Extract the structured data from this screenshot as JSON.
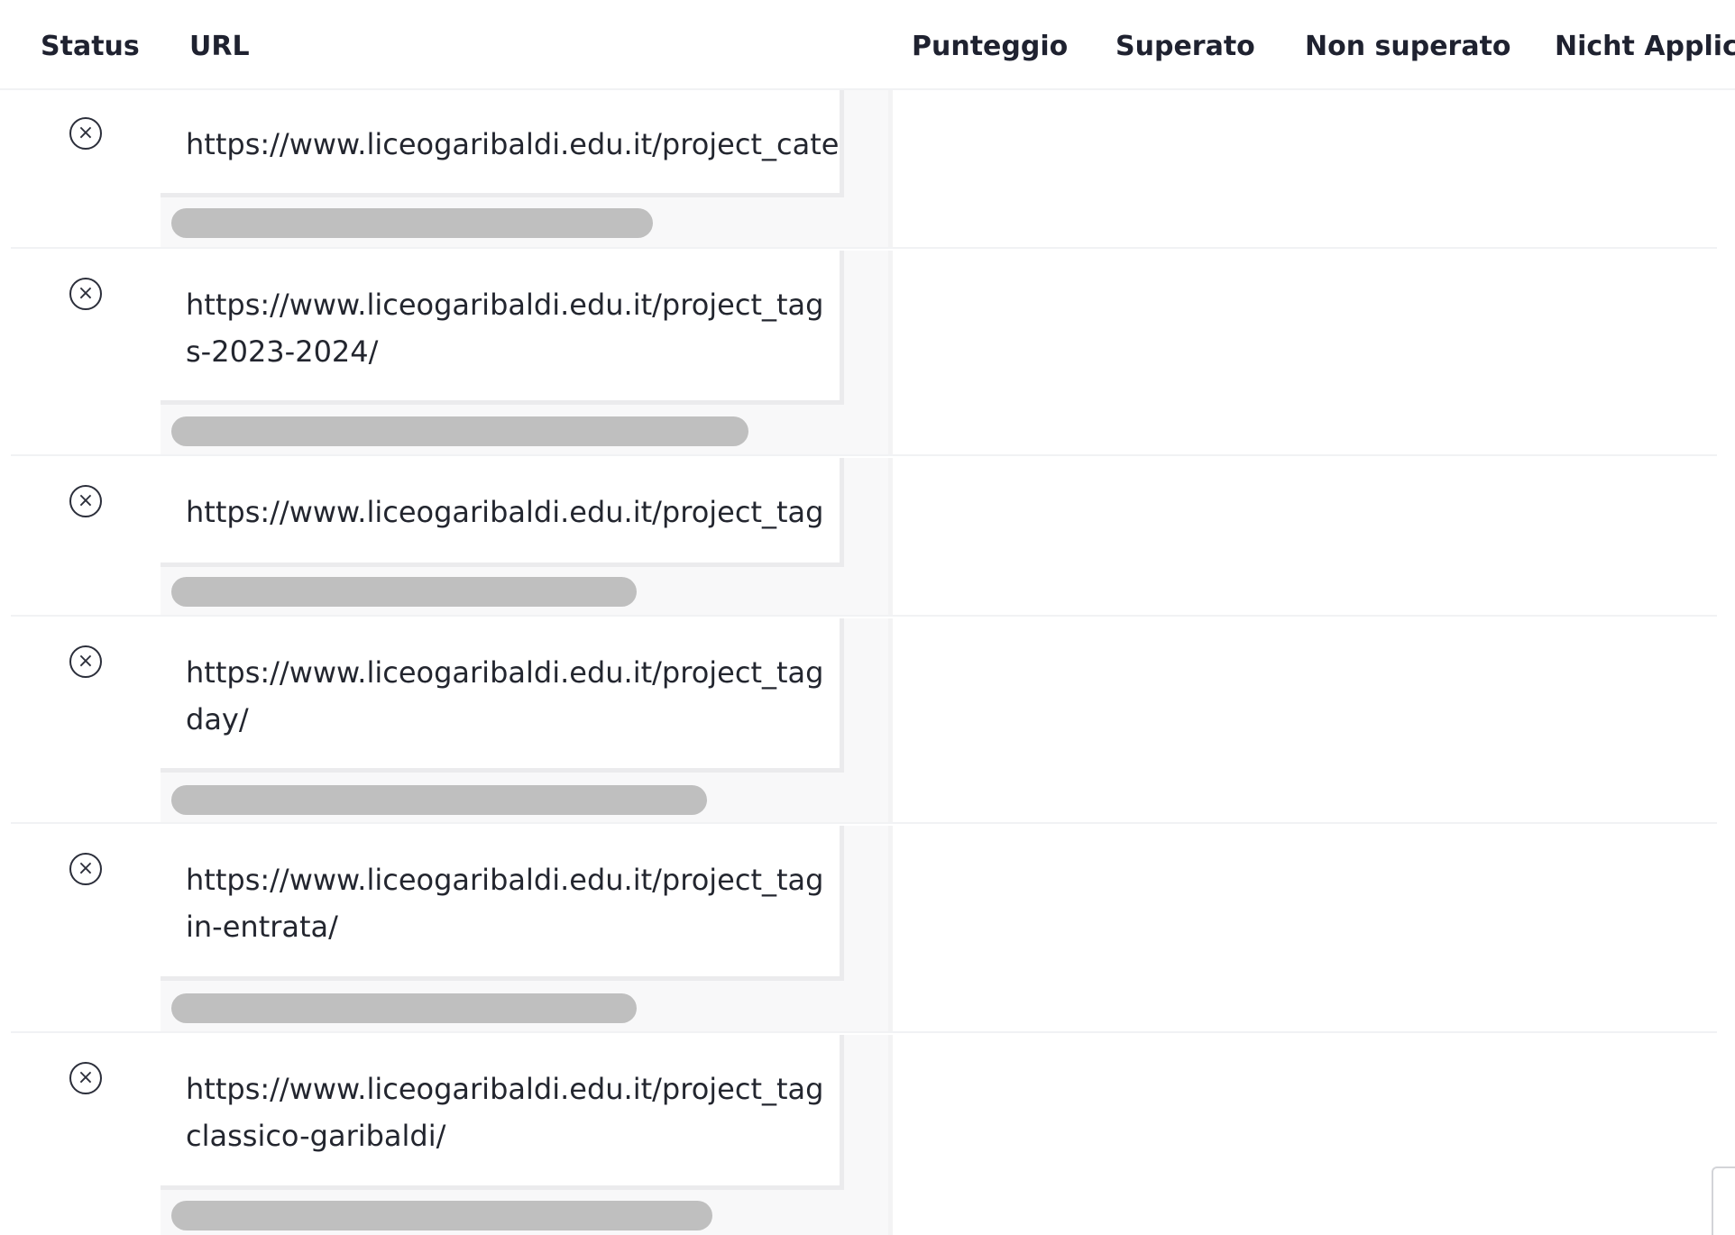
{
  "table": {
    "headers": {
      "status": "Status",
      "url": "URL",
      "score": "Punteggio",
      "passed": "Superato",
      "not_passed": "Non superato",
      "not_applicable": "Nicht Applic"
    },
    "rows": [
      {
        "status_icon": "circle-x-icon",
        "url_lines": [
          "https://www.liceogaribaldi.edu.it/project_cate"
        ]
      },
      {
        "status_icon": "circle-x-icon",
        "url_lines": [
          "https://www.liceogaribaldi.edu.it/project_tag",
          "s-2023-2024/"
        ]
      },
      {
        "status_icon": "circle-x-icon",
        "url_lines": [
          "https://www.liceogaribaldi.edu.it/project_tag"
        ]
      },
      {
        "status_icon": "circle-x-icon",
        "url_lines": [
          "https://www.liceogaribaldi.edu.it/project_tag",
          "day/"
        ]
      },
      {
        "status_icon": "circle-x-icon",
        "url_lines": [
          "https://www.liceogaribaldi.edu.it/project_tag",
          "in-entrata/"
        ]
      },
      {
        "status_icon": "circle-x-icon",
        "url_lines": [
          "https://www.liceogaribaldi.edu.it/project_tag",
          "classico-garibaldi/"
        ]
      }
    ]
  },
  "colors": {
    "text": "#1f2230",
    "skeleton": "#bfbfbf",
    "divider": "#f1f2f4",
    "panel": "#f8f8f9"
  }
}
